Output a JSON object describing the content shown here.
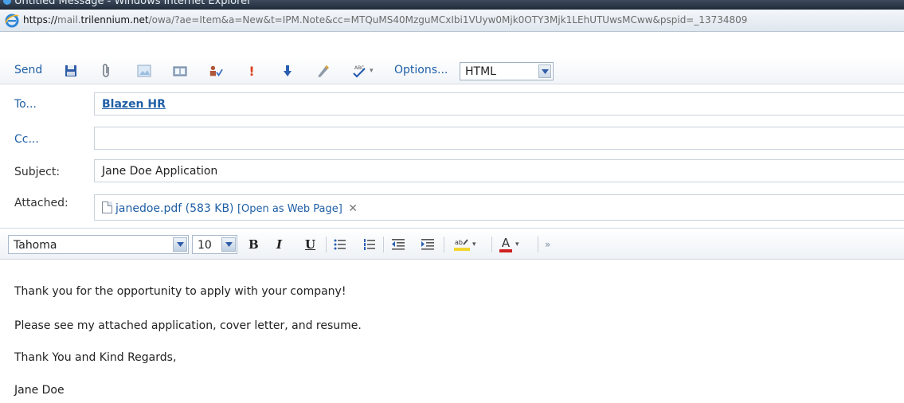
{
  "window": {
    "title": "Untitled Message - Windows Internet Explorer",
    "url_scheme": "https://",
    "url_subdomain": "mail.",
    "url_domain": "trilennium.net",
    "url_path": "/owa/?ae=Item&a=New&t=IPM.Note&cc=MTQuMS40MzguMCxIbi1VUyw0Mjk0OTY3Mjk1LEhUTUwsMCww&pspid=_13734809"
  },
  "toolbar": {
    "send_label": "Send",
    "options_label": "Options...",
    "format_value": "HTML"
  },
  "headers": {
    "to_label": "To...",
    "to_value": "Blazen HR",
    "cc_label": "Cc...",
    "cc_value": "",
    "subject_label": "Subject:",
    "subject_value": "Jane Doe Application",
    "attached_label": "Attached:",
    "attachment_name": "janedoe.pdf (583 KB)",
    "attachment_open": "[Open as Web Page]"
  },
  "formatting": {
    "font_value": "Tahoma",
    "size_value": "10",
    "bold_label": "B",
    "italic_label": "I",
    "underline_label": "U",
    "font_color_label": "A"
  },
  "body": {
    "lines": [
      "Thank you for the opportunity to apply with your company!",
      "Please see my attached application, cover letter, and resume.",
      "Thank You and Kind Regards,",
      "Jane Doe"
    ]
  },
  "colors": {
    "link": "#1f5fa5",
    "highlight": "#f2d630",
    "font_color": "#d02020",
    "importance_high": "#e04020",
    "importance_low": "#2a5fb0"
  }
}
